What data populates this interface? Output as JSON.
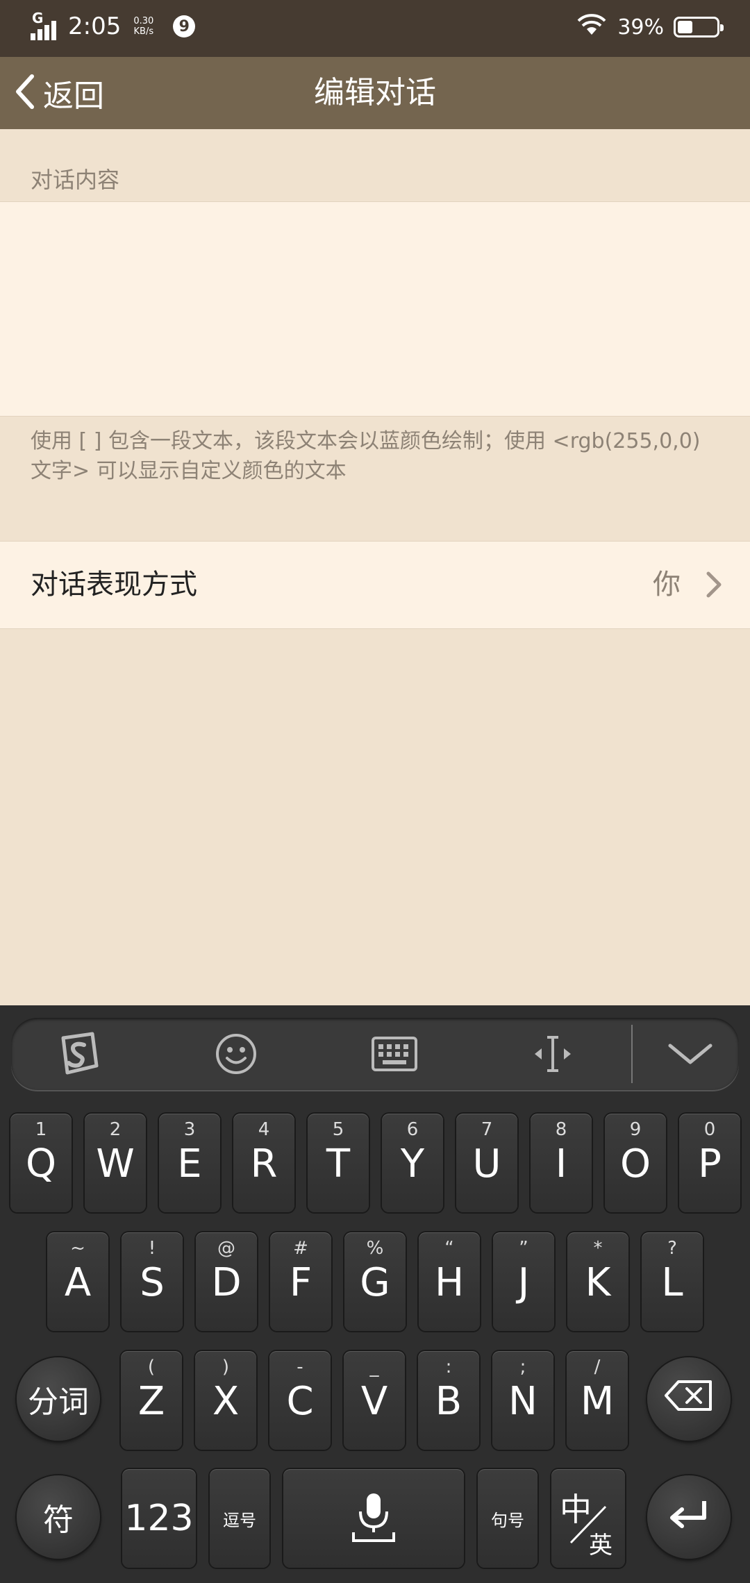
{
  "status": {
    "network_type": "G",
    "time": "2:05",
    "speed_value": "0.30",
    "speed_unit": "KB/s",
    "notification_count": "9",
    "battery": "39%",
    "battery_level": 0.39
  },
  "nav": {
    "back_label": "返回",
    "title": "编辑对话"
  },
  "content": {
    "section_label": "对话内容",
    "text_value": "",
    "hint": "使用 [ ] 包含一段文本，该段文本会以蓝颜色绘制；使用 <rgb(255,0,0)文字> 可以显示自定义颜色的文本"
  },
  "style_row": {
    "label": "对话表现方式",
    "value": "你"
  },
  "keyboard": {
    "toolbar_icons": [
      "sogou-logo-icon",
      "emoji-icon",
      "keyboard-icon",
      "cursor-icon",
      "collapse-icon"
    ],
    "row1": [
      {
        "num": "1",
        "letter": "Q"
      },
      {
        "num": "2",
        "letter": "W"
      },
      {
        "num": "3",
        "letter": "E"
      },
      {
        "num": "4",
        "letter": "R"
      },
      {
        "num": "5",
        "letter": "T"
      },
      {
        "num": "6",
        "letter": "Y"
      },
      {
        "num": "7",
        "letter": "U"
      },
      {
        "num": "8",
        "letter": "I"
      },
      {
        "num": "9",
        "letter": "O"
      },
      {
        "num": "0",
        "letter": "P"
      }
    ],
    "row2": [
      {
        "num": "~",
        "letter": "A"
      },
      {
        "num": "!",
        "letter": "S"
      },
      {
        "num": "@",
        "letter": "D"
      },
      {
        "num": "#",
        "letter": "F"
      },
      {
        "num": "%",
        "letter": "G"
      },
      {
        "num": "“",
        "letter": "H"
      },
      {
        "num": "”",
        "letter": "J"
      },
      {
        "num": "*",
        "letter": "K"
      },
      {
        "num": "?",
        "letter": "L"
      }
    ],
    "row3": [
      {
        "num": "(",
        "letter": "Z"
      },
      {
        "num": ")",
        "letter": "X"
      },
      {
        "num": "-",
        "letter": "C"
      },
      {
        "num": "_",
        "letter": "V"
      },
      {
        "num": ":",
        "letter": "B"
      },
      {
        "num": ";",
        "letter": "N"
      },
      {
        "num": "/",
        "letter": "M"
      }
    ],
    "segment_label": "分词",
    "symbol_label": "符",
    "numbers_label": "123",
    "comma_label": "逗号",
    "period_label": "句号",
    "lang_top": "中",
    "lang_bottom": "英"
  }
}
